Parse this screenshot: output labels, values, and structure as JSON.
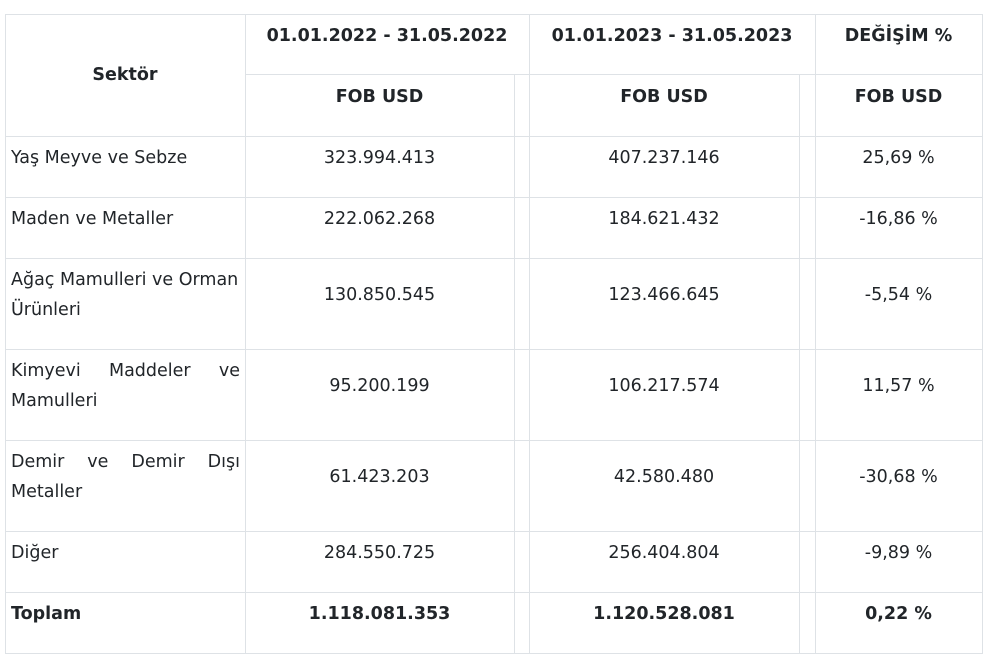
{
  "header": {
    "sector": "Sektör",
    "period_2022": "01.01.2022 - 31.05.2022",
    "period_2023": "01.01.2023 - 31.05.2023",
    "change": "DEĞİŞİM %",
    "fob_2022": "FOB USD",
    "fob_2023": "FOB USD",
    "fob_change": "FOB USD"
  },
  "rows": [
    {
      "sector": [
        "Yaş Meyve ve Sebze"
      ],
      "v2022": "323.994.413",
      "v2023": "407.237.146",
      "change": "25,69 %"
    },
    {
      "sector": [
        "Maden ve Metaller"
      ],
      "v2022": "222.062.268",
      "v2023": "184.621.432",
      "change": "-16,86 %"
    },
    {
      "sector": [
        "Ağaç Mamulleri ve Orman",
        "Ürünleri"
      ],
      "v2022": "130.850.545",
      "v2023": "123.466.645",
      "change": "-5,54 %"
    },
    {
      "sector": [
        "Kimyevi Maddeler ve",
        "Mamulleri"
      ],
      "v2022": "95.200.199",
      "v2023": "106.217.574",
      "change": "11,57 %"
    },
    {
      "sector": [
        "Demir ve Demir Dışı",
        "Metaller"
      ],
      "v2022": "61.423.203",
      "v2023": "42.580.480",
      "change": "-30,68 %"
    },
    {
      "sector": [
        "Diğer"
      ],
      "v2022": "284.550.725",
      "v2023": "256.404.804",
      "change": "-9,89 %"
    }
  ],
  "total": {
    "label": "Toplam",
    "v2022": "1.118.081.353",
    "v2023": "1.120.528.081",
    "change": "0,22 %"
  }
}
